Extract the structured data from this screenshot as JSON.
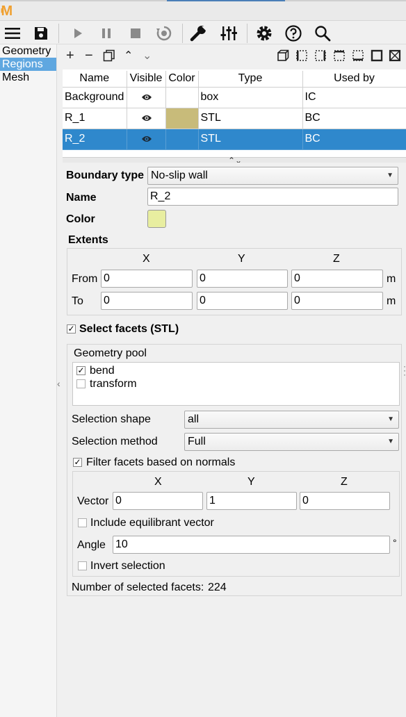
{
  "app": {
    "logo_text": "M"
  },
  "toolbar": {
    "icons": [
      "menu-icon",
      "save-icon",
      "play-icon",
      "pause-icon",
      "stop-icon",
      "reset-icon",
      "wrench-icon",
      "sliders-icon",
      "gear-icon",
      "help-icon",
      "search-icon"
    ]
  },
  "sidebar": {
    "items": [
      {
        "label": "Geometry",
        "selected": false
      },
      {
        "label": "Regions",
        "selected": true
      },
      {
        "label": "Mesh",
        "selected": false
      }
    ]
  },
  "region_toolbar": {
    "add": "+",
    "remove": "−",
    "up": "⌃",
    "down": "⌄"
  },
  "regions_table": {
    "headers": [
      "Name",
      "Visible",
      "Color",
      "Type",
      "Used by"
    ],
    "rows": [
      {
        "name": "Background",
        "visible": true,
        "color": "",
        "type": "box",
        "used_by": "IC",
        "selected": false
      },
      {
        "name": "R_1",
        "visible": true,
        "color": "#c8bb7a",
        "type": "STL",
        "used_by": "BC",
        "selected": false
      },
      {
        "name": "R_2",
        "visible": true,
        "color": "",
        "type": "STL",
        "used_by": "BC",
        "selected": true
      }
    ]
  },
  "form": {
    "boundary_type_label": "Boundary type",
    "boundary_type_value": "No-slip wall",
    "name_label": "Name",
    "name_value": "R_2",
    "color_label": "Color",
    "color_value": "#e8eea0",
    "extents": {
      "title": "Extents",
      "col_x": "X",
      "col_y": "Y",
      "col_z": "Z",
      "from_label": "From",
      "to_label": "To",
      "from": [
        "0",
        "0",
        "0"
      ],
      "to": [
        "0",
        "0",
        "0"
      ],
      "unit": "m"
    },
    "select_facets_label": "Select facets (STL)",
    "select_facets_checked": true,
    "geometry_pool": {
      "title": "Geometry pool",
      "items": [
        {
          "label": "bend",
          "checked": true
        },
        {
          "label": "transform",
          "checked": false
        }
      ]
    },
    "selection_shape_label": "Selection shape",
    "selection_shape_value": "all",
    "selection_method_label": "Selection method",
    "selection_method_value": "Full",
    "filter_normals_label": "Filter facets based on normals",
    "filter_normals_checked": true,
    "normals": {
      "col_x": "X",
      "col_y": "Y",
      "col_z": "Z",
      "vector_label": "Vector",
      "vector": [
        "0",
        "1",
        "0"
      ],
      "equilibrant_label": "Include equilibrant vector",
      "equilibrant_checked": false,
      "angle_label": "Angle",
      "angle_value": "10",
      "angle_unit": "°",
      "invert_label": "Invert selection",
      "invert_checked": false
    },
    "selected_facets_label": "Number of selected facets:",
    "selected_facets_value": "224"
  }
}
